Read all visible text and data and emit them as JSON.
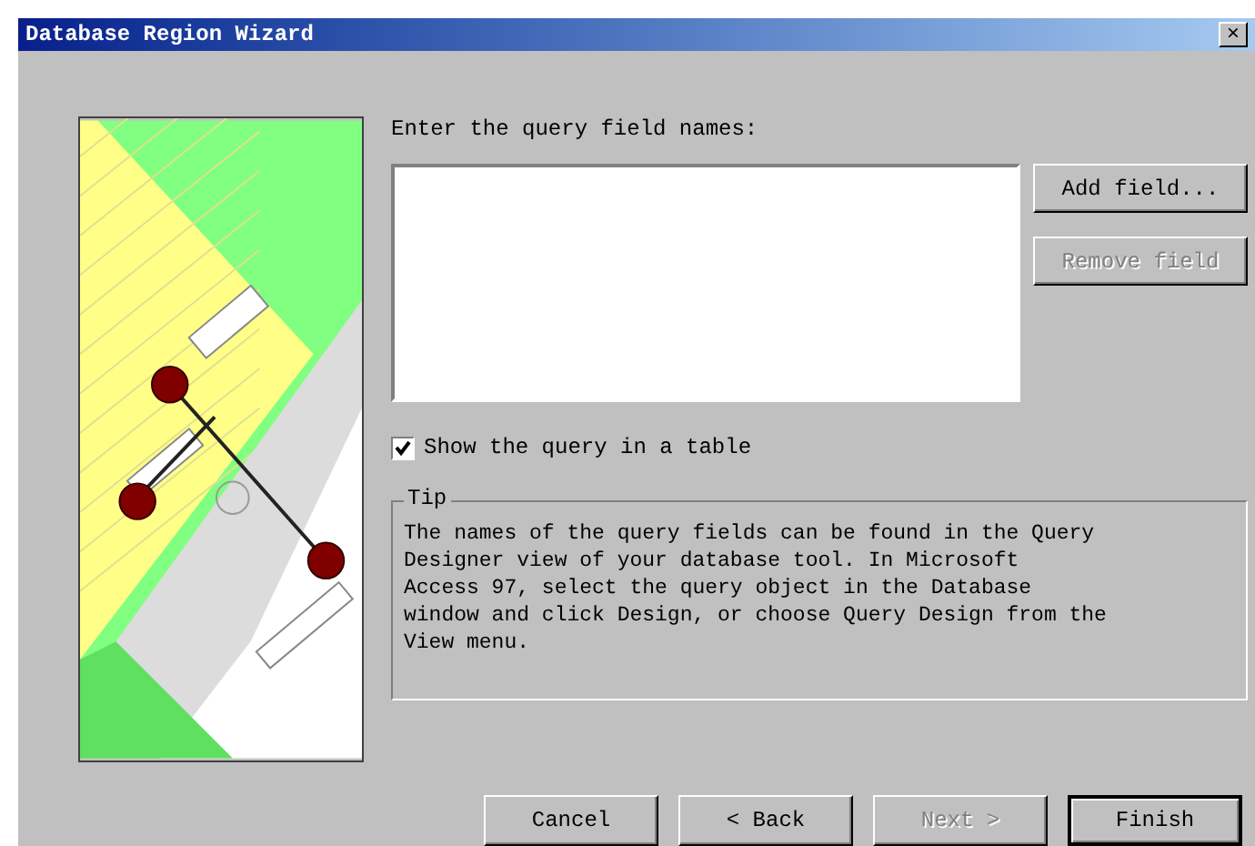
{
  "window": {
    "title": "Database Region Wizard",
    "close": "×"
  },
  "prompt": "Enter the query field names:",
  "side_buttons": [
    {
      "label": "Add field...",
      "disabled": false
    },
    {
      "label": "Remove field",
      "disabled": true
    }
  ],
  "checkbox": {
    "label": "Show the query in a table",
    "checked": true
  },
  "tip": {
    "title": "Tip",
    "text": "The names of the query fields can be found in the Query\nDesigner view of your database tool.  In Microsoft\nAccess 97, select the query object in the Database\nwindow and click Design, or choose Query Design from the\nView menu."
  },
  "buttons": [
    {
      "label": "Cancel",
      "disabled": false,
      "default": false
    },
    {
      "label": "< Back",
      "disabled": false,
      "default": false
    },
    {
      "label": "Next >",
      "disabled": true,
      "default": false
    },
    {
      "label": "Finish",
      "disabled": false,
      "default": true
    }
  ]
}
